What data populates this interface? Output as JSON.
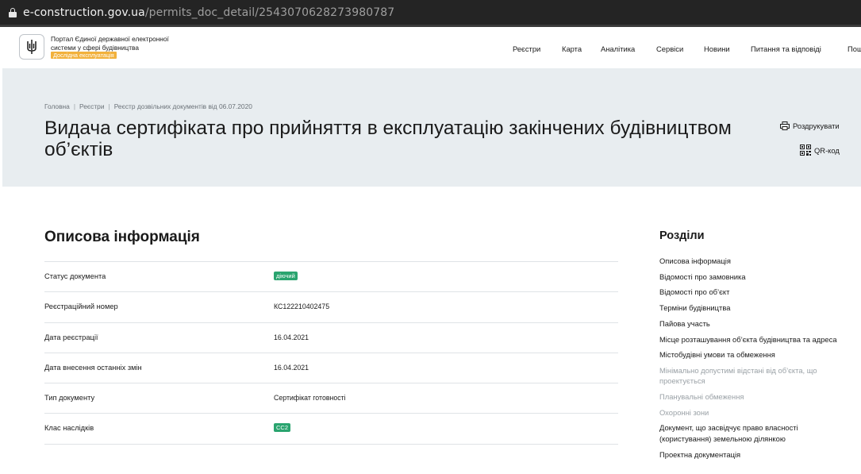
{
  "browser": {
    "url_host": "e-construction.gov.ua",
    "url_path": "/permits_doc_detail/2543070628273980787"
  },
  "header": {
    "portal_name": "Портал Єдиної державної електронної системи у сфері будівництва",
    "badge": "Дослідна експлуатація",
    "nav": [
      "Реєстри",
      "Карта",
      "Аналітика",
      "Сервіси",
      "Новини",
      "Питання та відповіді",
      "Пош"
    ]
  },
  "breadcrumbs": [
    "Головна",
    "Реєстри",
    "Реєстр дозвільних документів від 06.07.2020"
  ],
  "page_title": "Видача сертифіката про прийняття в експлуатацію закінчених будівництвом об’єктів",
  "actions": {
    "print": "Роздрукувати",
    "qr": "QR-код"
  },
  "section": {
    "title": "Описова інформація",
    "rows": [
      {
        "label": "Статус документа",
        "value": "діючий",
        "tag": true
      },
      {
        "label": "Реєстраційний номер",
        "value": "КС122210402475",
        "tag": false
      },
      {
        "label": "Дата реєстрації",
        "value": "16.04.2021",
        "tag": false
      },
      {
        "label": "Дата внесення останніх змін",
        "value": "16.04.2021",
        "tag": false
      },
      {
        "label": "Тип документу",
        "value": "Сертифікат готовності",
        "tag": false
      },
      {
        "label": "Клас наслідків",
        "value": "СС2",
        "tag": true
      }
    ]
  },
  "toc": {
    "title": "Розділи",
    "items": [
      {
        "label": "Описова інформація",
        "muted": false
      },
      {
        "label": "Відомості про замовника",
        "muted": false
      },
      {
        "label": "Відомості про об’єкт",
        "muted": false
      },
      {
        "label": "Терміни будівництва",
        "muted": false
      },
      {
        "label": "Пайова участь",
        "muted": false
      },
      {
        "label": "Місце розташування об’єкта будівництва та адреса",
        "muted": false
      },
      {
        "label": "Містобудівні умови та обмеження",
        "muted": false
      },
      {
        "label": "Мінімально допустимі відстані від об’єкта, що проектується",
        "muted": true
      },
      {
        "label": "Планувальні обмеження",
        "muted": true
      },
      {
        "label": "Охоронні зони",
        "muted": true
      },
      {
        "label": "Документ, що засвідчує право власності (користування) земельною ділянкою",
        "muted": false
      },
      {
        "label": "Проектна документація",
        "muted": false
      }
    ]
  }
}
